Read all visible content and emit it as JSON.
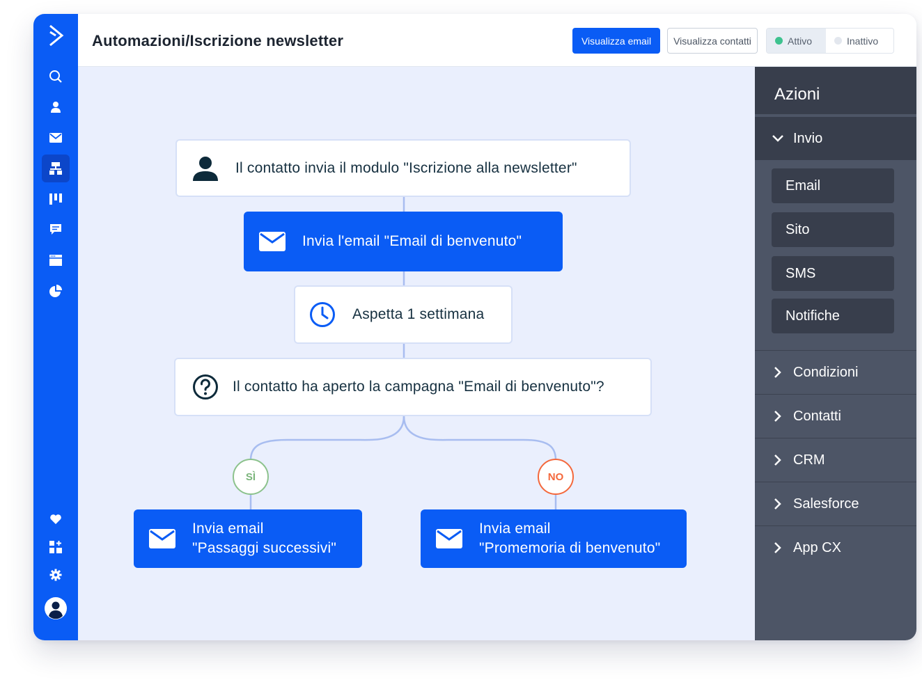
{
  "header": {
    "title": "Automazioni/Iscrizione newsletter",
    "view_email_label": "Visualizza email",
    "view_contacts_label": "Visualizza contatti",
    "status_active_label": "Attivo",
    "status_inactive_label": "Inattivo",
    "selected_status": "Attivo"
  },
  "sidebar": {
    "items": [
      {
        "icon": "search-icon"
      },
      {
        "icon": "contacts-icon"
      },
      {
        "icon": "campaigns-envelope-icon"
      },
      {
        "icon": "automations-icon",
        "active": true
      },
      {
        "icon": "deals-board-icon"
      },
      {
        "icon": "conversations-icon"
      },
      {
        "icon": "website-icon"
      },
      {
        "icon": "reports-pie-icon"
      }
    ],
    "bottom_items": [
      {
        "icon": "heart-icon"
      },
      {
        "icon": "apps-add-icon"
      },
      {
        "icon": "settings-gear-icon"
      },
      {
        "icon": "user-avatar-icon"
      }
    ]
  },
  "workflow": {
    "trigger": {
      "icon": "person-icon",
      "text": "Il contatto invia il modulo \"Iscrizione alla newsletter\""
    },
    "send_email": {
      "icon": "envelope-icon",
      "text": "Invia l'email \"Email di benvenuto\""
    },
    "wait": {
      "icon": "clock-icon",
      "text": "Aspetta 1 settimana"
    },
    "condition": {
      "icon": "question-icon",
      "text": "Il contatto ha aperto la campagna \"Email di benvenuto\"?"
    },
    "yes_label": "SÌ",
    "no_label": "NO",
    "yes_action": {
      "icon": "envelope-icon",
      "line1": "Invia email",
      "line2": "\"Passaggi successivi\""
    },
    "no_action": {
      "icon": "envelope-icon",
      "line1": "Invia email",
      "line2": "\"Promemoria di benvenuto\""
    }
  },
  "panel": {
    "title": "Azioni",
    "expanded_group": "Invio",
    "send_actions": [
      "Email",
      "Sito",
      "SMS",
      "Notifiche"
    ],
    "sections": [
      "Condizioni",
      "Contatti",
      "CRM",
      "Salesforce",
      "App CX"
    ]
  },
  "colors": {
    "brand_blue": "#0a5cf5",
    "active_dot": "#3ec28f",
    "yes_green": "#8cc28c",
    "no_orange": "#f4683c",
    "panel_dark": "#383e4c",
    "panel_mid": "#4d5566",
    "canvas_bg": "#eaeffd"
  }
}
